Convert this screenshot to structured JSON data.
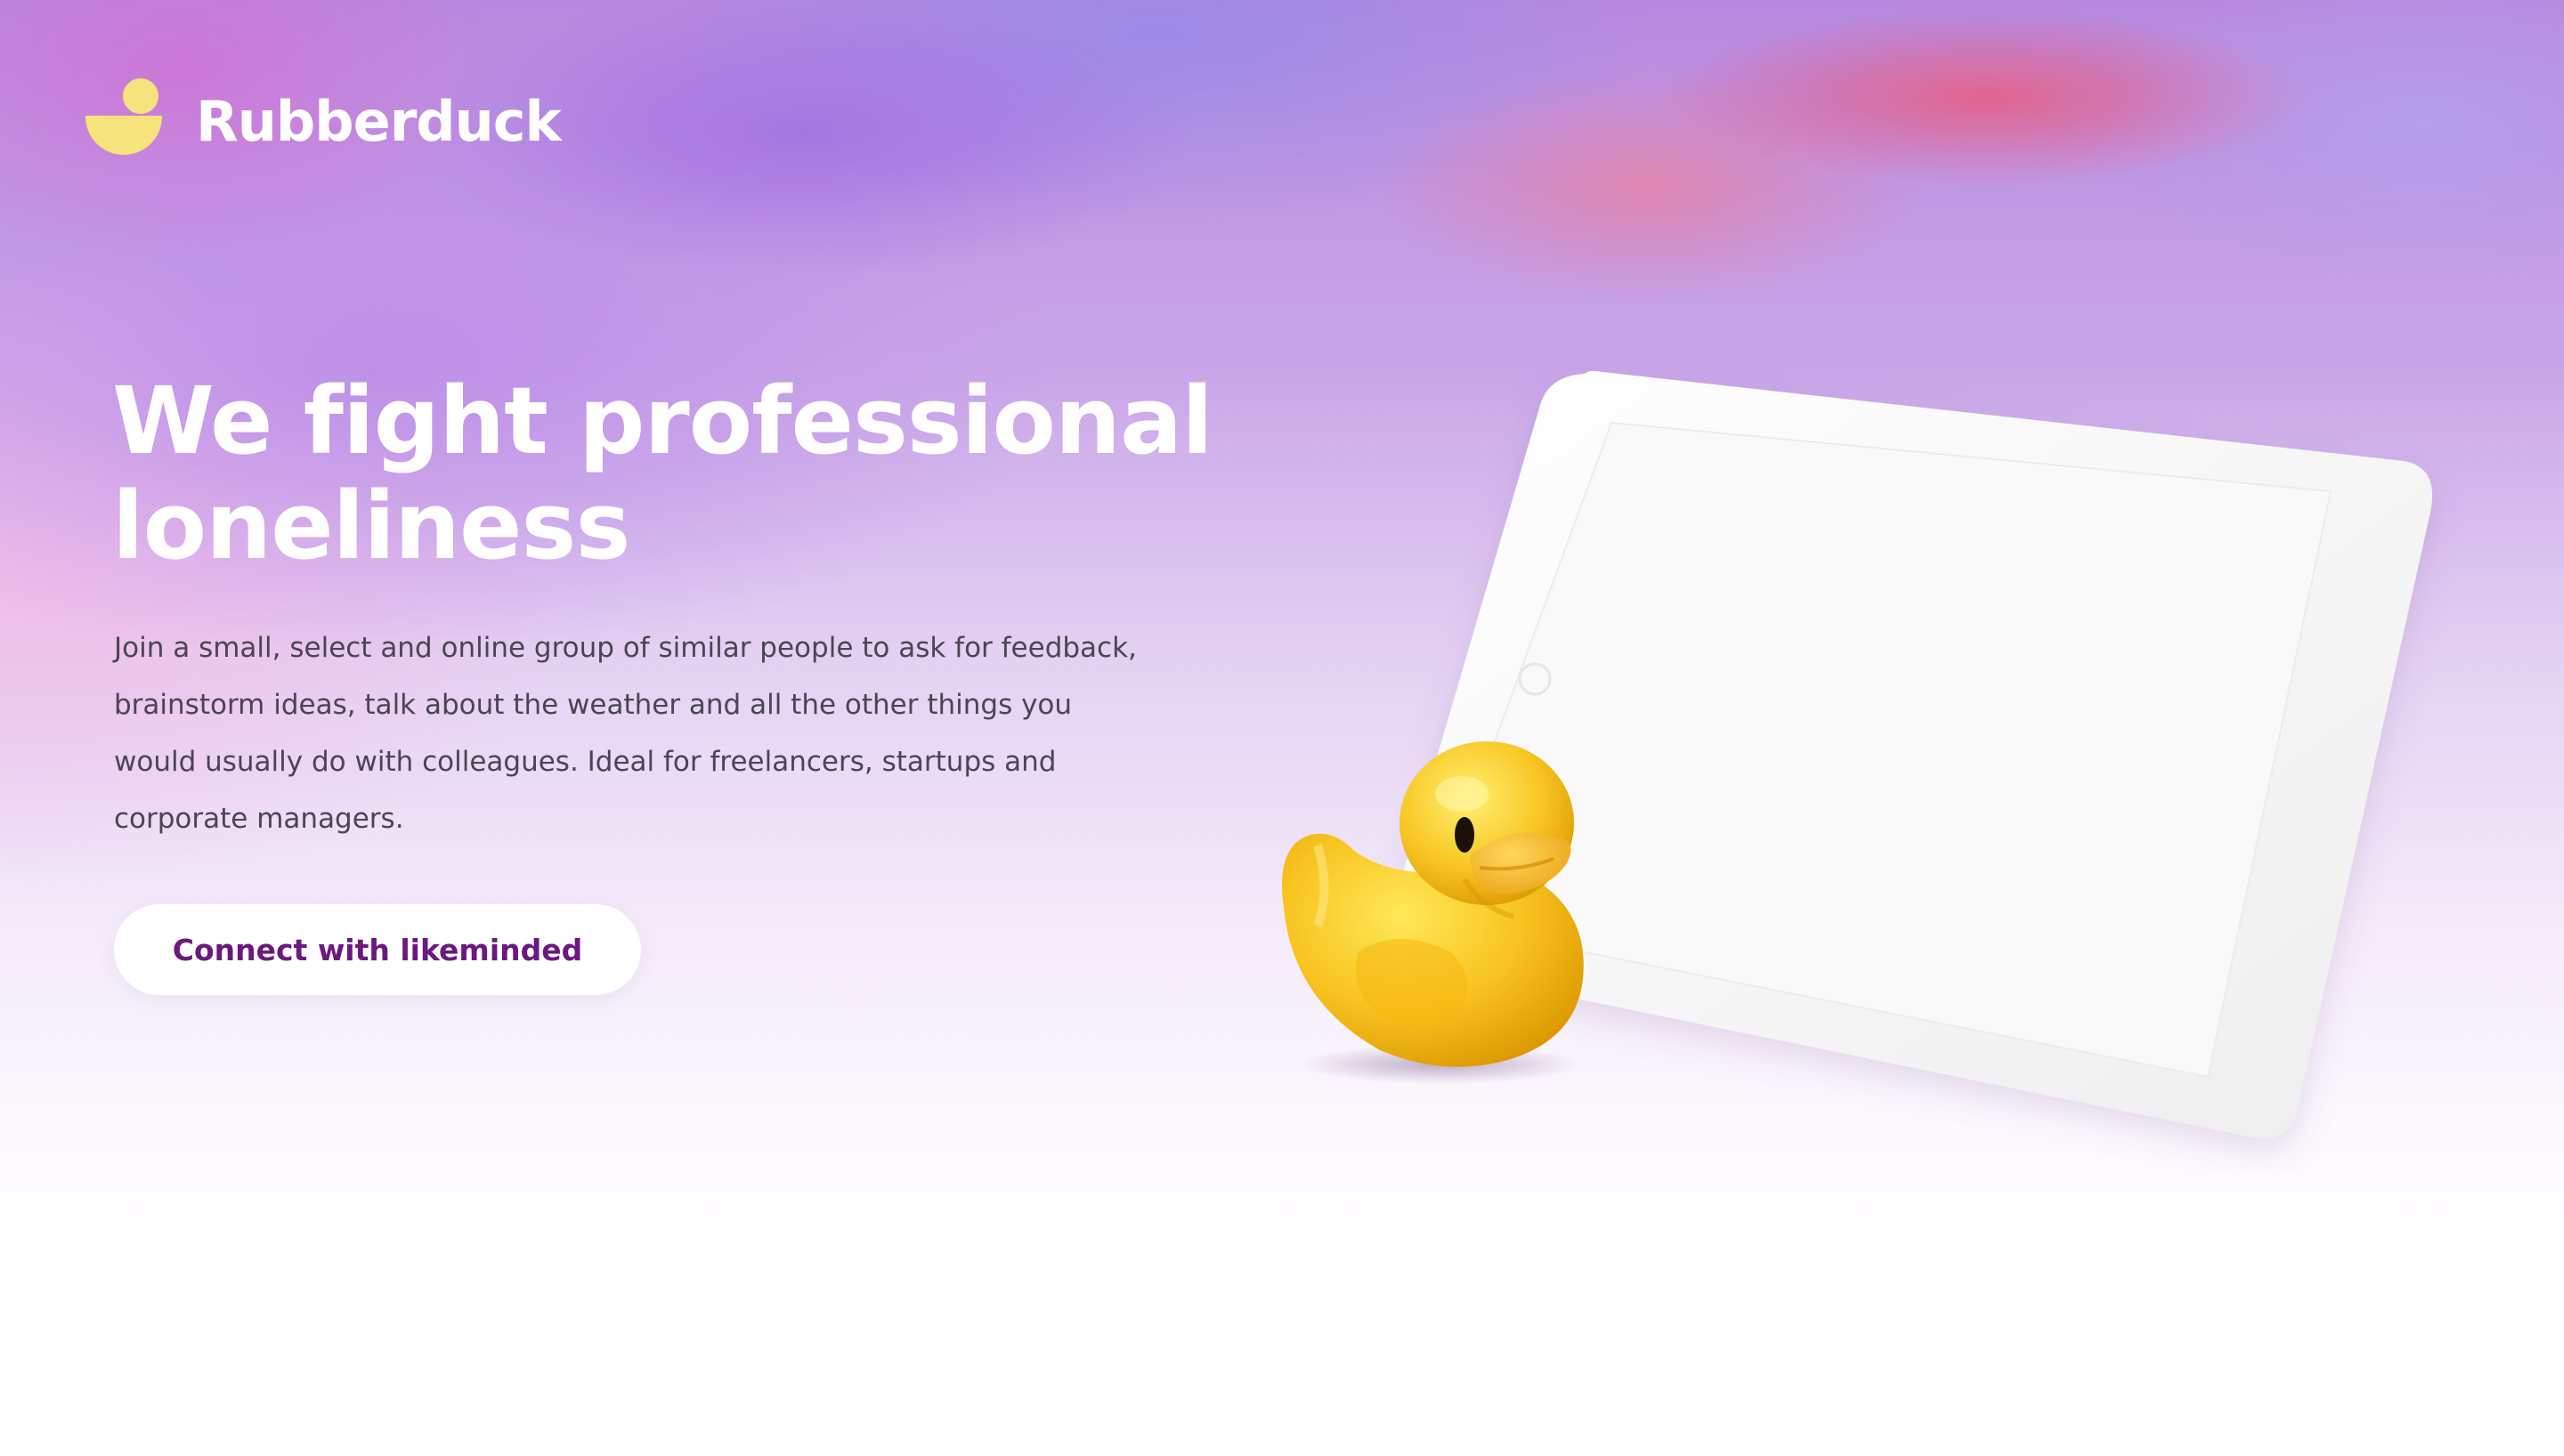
{
  "brand": {
    "name": "Rubberduck",
    "logo_icon": "duck-logo-icon",
    "logo_color": "#f5e37c"
  },
  "hero": {
    "headline": "We fight professional loneliness",
    "description": "Join a small, select and online group of similar people to ask for feedback, brainstorm ideas, talk about the weather and all the other things you would usually do with colleagues. Ideal for freelancers, startups and corporate managers.",
    "cta_label": "Connect with likeminded"
  },
  "illustration": {
    "items": [
      "tablet-device",
      "rubber-duck"
    ]
  },
  "colors": {
    "cta_text": "#6c1880",
    "body_text": "#4a4552",
    "duck_yellow": "#f5c21a"
  }
}
